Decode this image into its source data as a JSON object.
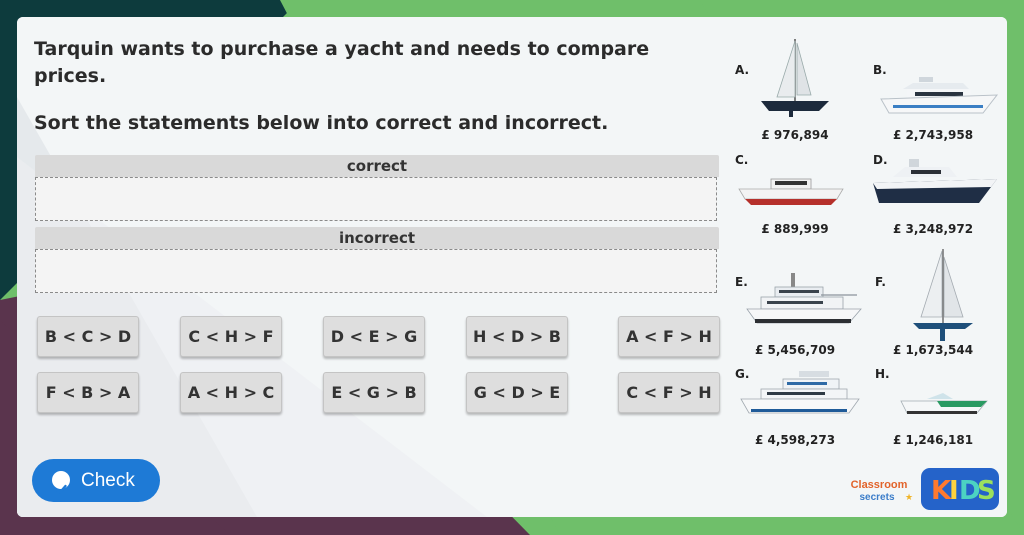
{
  "question": {
    "line1": "Tarquin wants to purchase a yacht and needs to compare prices.",
    "line2": "Sort the statements below into correct and incorrect."
  },
  "zones": {
    "correct_label": "correct",
    "incorrect_label": "incorrect"
  },
  "tiles": [
    "B < C > D",
    "C < H > F",
    "D < E > G",
    "H < D > B",
    "A < F > H",
    "F < B > A",
    "A < H > C",
    "E < G > B",
    "G < D > E",
    "C < F > H"
  ],
  "boats": [
    {
      "letter": "A.",
      "price": "£ 976,894"
    },
    {
      "letter": "B.",
      "price": "£ 2,743,958"
    },
    {
      "letter": "C.",
      "price": "£ 889,999"
    },
    {
      "letter": "D.",
      "price": "£ 3,248,972"
    },
    {
      "letter": "E.",
      "price": "£ 5,456,709"
    },
    {
      "letter": "F.",
      "price": "£ 1,673,544"
    },
    {
      "letter": "G.",
      "price": "£ 4,598,273"
    },
    {
      "letter": "H.",
      "price": "£ 1,246,181"
    }
  ],
  "check_button": {
    "label": "Check"
  },
  "logos": {
    "classroom": "Classroom",
    "secrets": "secrets",
    "kids": "KIDS"
  },
  "colors": {
    "frame_green": "#6fbf6a",
    "frame_dark": "#0d3b3d",
    "frame_plum": "#5a344d",
    "check_blue": "#1e7ad6"
  }
}
